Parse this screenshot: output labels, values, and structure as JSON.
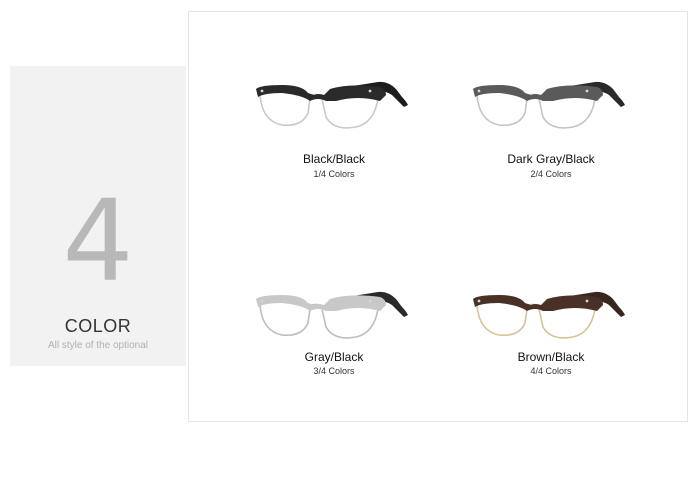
{
  "side": {
    "number": "4",
    "title": "COLOR",
    "subtitle": "All style of the optional"
  },
  "products": [
    {
      "name": "Black/Black",
      "count": "1/4  Colors",
      "frame_color": "#2a2a2a",
      "temple_color": "#1d1d1d",
      "rim_color": "#c9c9c9"
    },
    {
      "name": "Dark Gray/Black",
      "count": "2/4  Colors",
      "frame_color": "#5a5a5a",
      "temple_color": "#2a2a2a",
      "rim_color": "#c4c4c4"
    },
    {
      "name": "Gray/Black",
      "count": "3/4  Colors",
      "frame_color": "#c8c8c8",
      "temple_color": "#2a2a2a",
      "rim_color": "#bdbdbd"
    },
    {
      "name": "Brown/Black",
      "count": "4/4  Colors",
      "frame_color": "#4a3128",
      "temple_color": "#3a2620",
      "rim_color": "#d8c29a"
    }
  ]
}
